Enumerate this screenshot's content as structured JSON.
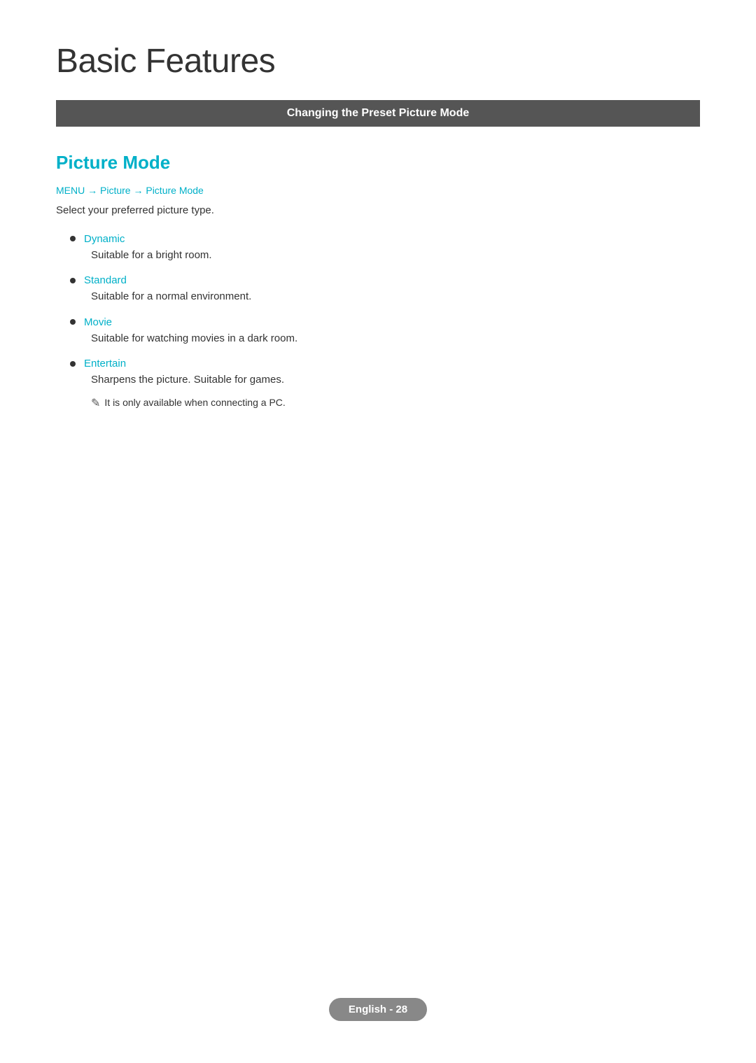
{
  "page": {
    "title": "Basic Features",
    "section_header": "Changing the Preset Picture Mode",
    "section_title": "Picture Mode",
    "menu_path": "MENU → Picture → Picture Mode",
    "intro_text": "Select your preferred picture type.",
    "list_items": [
      {
        "label": "Dynamic",
        "description": "Suitable for a bright room."
      },
      {
        "label": "Standard",
        "description": "Suitable for a normal environment."
      },
      {
        "label": "Movie",
        "description": "Suitable for watching movies in a dark room."
      },
      {
        "label": "Entertain",
        "description": "Sharpens the picture. Suitable for games.",
        "note": "It is only available when connecting a PC."
      }
    ],
    "footer": {
      "label": "English - 28"
    }
  }
}
